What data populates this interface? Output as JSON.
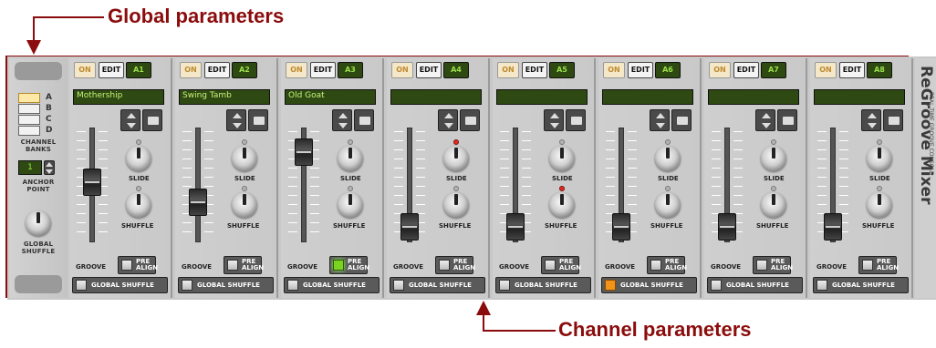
{
  "annotations": {
    "global_parameters": "Global parameters",
    "channel_parameters": "Channel parameters"
  },
  "global": {
    "bank_letters": [
      "A",
      "B",
      "C",
      "D"
    ],
    "selected_bank": "A",
    "channel_banks_label": "CHANNEL\nBANKS",
    "anchor_value": "1",
    "anchor_label": "ANCHOR\nPOINT",
    "global_shuffle_label": "GLOBAL\nSHUFFLE"
  },
  "channel_labels": {
    "on": "ON",
    "edit": "EDIT",
    "slide": "SLIDE",
    "shuffle": "SHUFFLE",
    "groove": "GROOVE",
    "pre_align": "PRE\nALIGN",
    "global_shuffle": "GLOBAL SHUFFLE"
  },
  "channels": [
    {
      "id": "A1",
      "name": "Mothership",
      "groove_level": 0.45,
      "slide_red": false,
      "shuffle_red": false,
      "pre_align_on": false,
      "global_shuffle_on": false
    },
    {
      "id": "A2",
      "name": "Swing Tamb",
      "groove_level": 0.25,
      "slide_red": false,
      "shuffle_red": false,
      "pre_align_on": false,
      "global_shuffle_on": false
    },
    {
      "id": "A3",
      "name": "Old Goat",
      "groove_level": 0.75,
      "slide_red": false,
      "shuffle_red": false,
      "pre_align_on": true,
      "global_shuffle_on": false
    },
    {
      "id": "A4",
      "name": "",
      "groove_level": 0.0,
      "slide_red": true,
      "shuffle_red": false,
      "pre_align_on": false,
      "global_shuffle_on": false
    },
    {
      "id": "A5",
      "name": "",
      "groove_level": 0.0,
      "slide_red": false,
      "shuffle_red": true,
      "pre_align_on": false,
      "global_shuffle_on": false
    },
    {
      "id": "A6",
      "name": "",
      "groove_level": 0.0,
      "slide_red": false,
      "shuffle_red": false,
      "pre_align_on": false,
      "global_shuffle_on": true
    },
    {
      "id": "A7",
      "name": "",
      "groove_level": 0.0,
      "slide_red": false,
      "shuffle_red": false,
      "pre_align_on": false,
      "global_shuffle_on": false
    },
    {
      "id": "A8",
      "name": "",
      "groove_level": 0.0,
      "slide_red": false,
      "shuffle_red": false,
      "pre_align_on": false,
      "global_shuffle_on": false
    }
  ],
  "brand": {
    "title": "ReGroove Mixer",
    "subtitle": "REAL TIME GROOVE CONSOLE"
  },
  "colors": {
    "annotation": "#8b0c0c",
    "lcd_bg": "#2e4a12",
    "lcd_text": "#c8f27a",
    "pre_align_on": "#7bd321",
    "global_shuffle_on": "#f2941a",
    "knob_dot_active": "#e62a1e"
  }
}
